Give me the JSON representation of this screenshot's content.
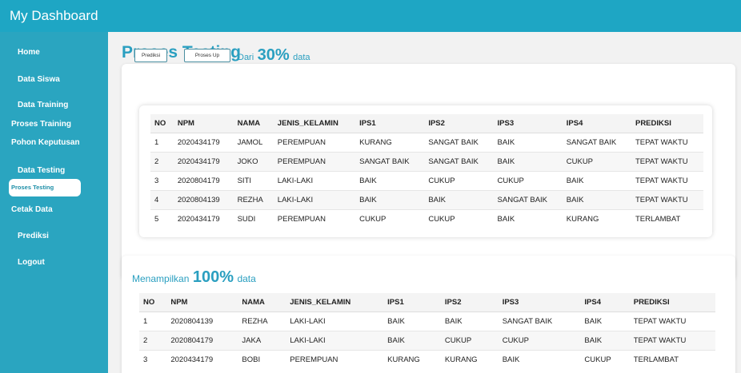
{
  "app": {
    "title": "My Dashboard"
  },
  "sidebar": {
    "items": [
      {
        "label": "Home"
      },
      {
        "label": "Data Siswa"
      },
      {
        "label": "Data Training"
      },
      {
        "label": "Proses Training"
      },
      {
        "label": "Pohon Keputusan"
      },
      {
        "label": "Data Testing"
      },
      {
        "label": "Proses Testing",
        "active": true
      },
      {
        "label": "Cetak Data"
      },
      {
        "label": "Prediksi"
      },
      {
        "label": "Logout"
      }
    ]
  },
  "main": {
    "page_title": "Proses Testing",
    "buttons": {
      "prediksi": "Prediksi",
      "proses_up": "Proses Up"
    },
    "section1": {
      "prefix": "Dari",
      "percent": "30%",
      "suffix": "data"
    },
    "section2": {
      "prefix": "Menampilkan",
      "percent": "100%",
      "suffix": "data"
    },
    "table_headers": [
      "NO",
      "NPM",
      "NAMA",
      "JENIS_KELAMIN",
      "IPS1",
      "IPS2",
      "IPS3",
      "IPS4",
      "PREDIKSI"
    ],
    "table1_rows": [
      [
        "1",
        "2020434179",
        "JAMOL",
        "PEREMPUAN",
        "KURANG",
        "SANGAT BAIK",
        "BAIK",
        "SANGAT BAIK",
        "TEPAT WAKTU"
      ],
      [
        "2",
        "2020434179",
        "JOKO",
        "PEREMPUAN",
        "SANGAT BAIK",
        "SANGAT BAIK",
        "BAIK",
        "CUKUP",
        "TEPAT WAKTU"
      ],
      [
        "3",
        "2020804179",
        "SITI",
        "LAKI-LAKI",
        "BAIK",
        "CUKUP",
        "CUKUP",
        "BAIK",
        "TEPAT WAKTU"
      ],
      [
        "4",
        "2020804139",
        "REZHA",
        "LAKI-LAKI",
        "BAIK",
        "BAIK",
        "SANGAT BAIK",
        "BAIK",
        "TEPAT WAKTU"
      ],
      [
        "5",
        "2020434179",
        "SUDI",
        "PEREMPUAN",
        "CUKUP",
        "CUKUP",
        "BAIK",
        "KURANG",
        "TERLAMBAT"
      ]
    ],
    "table2_rows": [
      [
        "1",
        "2020804139",
        "REZHA",
        "LAKI-LAKI",
        "BAIK",
        "BAIK",
        "SANGAT BAIK",
        "BAIK",
        "TEPAT WAKTU"
      ],
      [
        "2",
        "2020804179",
        "JAKA",
        "LAKI-LAKI",
        "BAIK",
        "CUKUP",
        "CUKUP",
        "BAIK",
        "TEPAT WAKTU"
      ],
      [
        "3",
        "2020434179",
        "BOBI",
        "PEREMPUAN",
        "KURANG",
        "KURANG",
        "BAIK",
        "CUKUP",
        "TERLAMBAT"
      ]
    ]
  }
}
